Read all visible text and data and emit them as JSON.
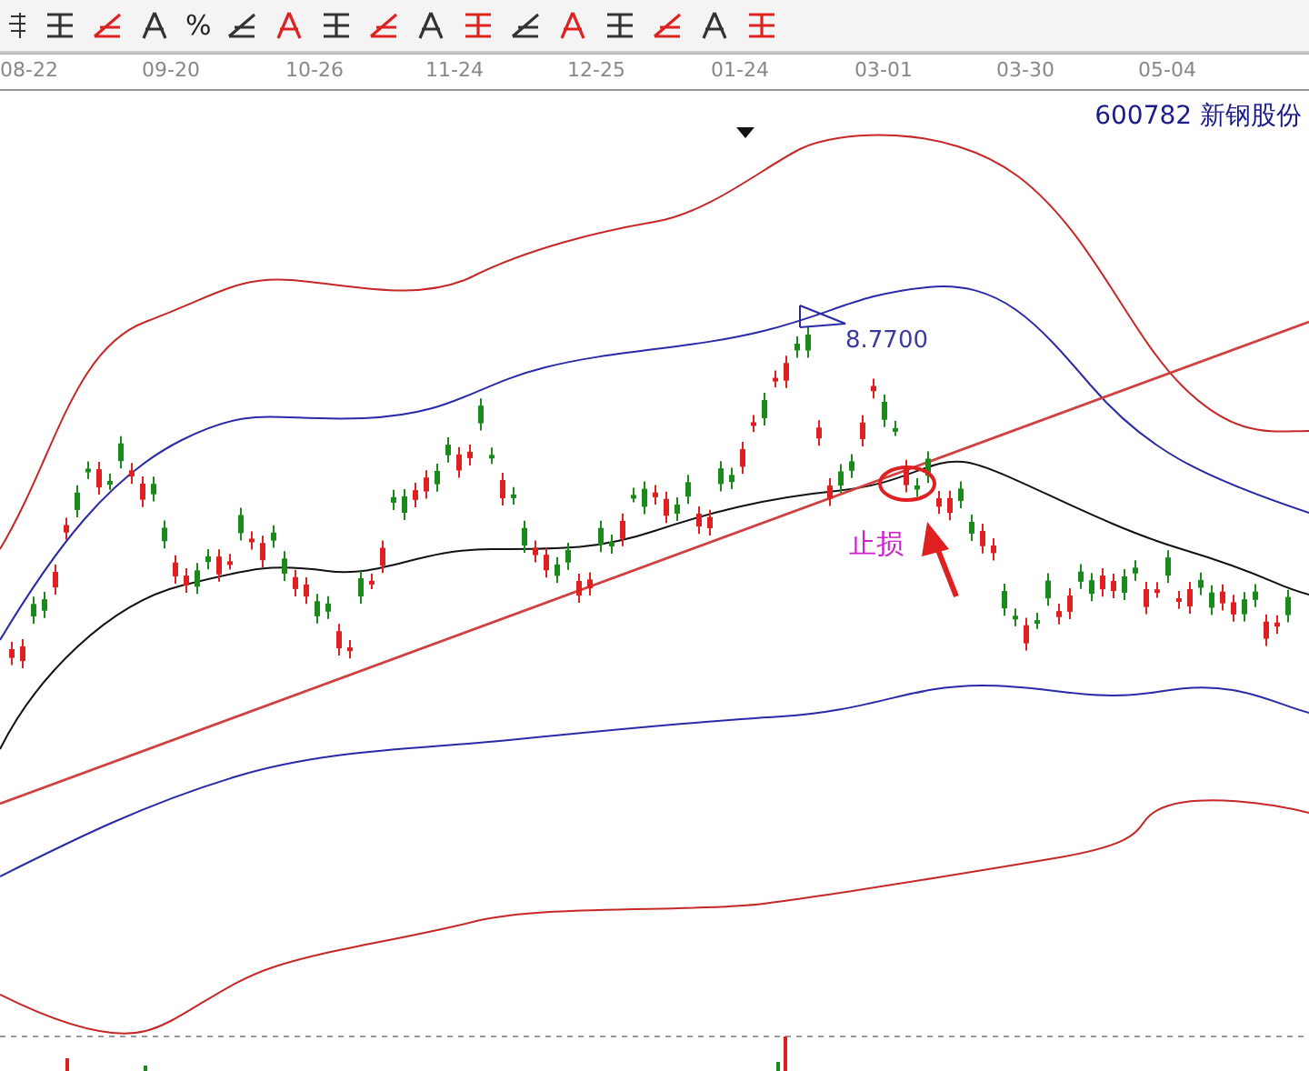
{
  "toolbar": {
    "items": [
      {
        "kind": "icon"
      },
      {
        "kind": "icon"
      },
      {
        "kind": "icon"
      },
      {
        "kind": "text",
        "label": "%"
      },
      {
        "kind": "icon"
      },
      {
        "kind": "icon"
      },
      {
        "kind": "icon"
      },
      {
        "kind": "icon"
      },
      {
        "kind": "icon"
      },
      {
        "kind": "icon"
      },
      {
        "kind": "icon"
      },
      {
        "kind": "icon"
      },
      {
        "kind": "icon"
      },
      {
        "kind": "icon"
      },
      {
        "kind": "icon"
      },
      {
        "kind": "icon"
      }
    ]
  },
  "date_axis": {
    "labels": [
      "08-22",
      "09-20",
      "10-26",
      "11-24",
      "12-25",
      "01-24",
      "03-01",
      "03-30",
      "05-04"
    ]
  },
  "chart": {
    "stock_title": "600782  新钢股份",
    "peak_label": "8.7700",
    "stop_loss_label": "止损"
  }
}
